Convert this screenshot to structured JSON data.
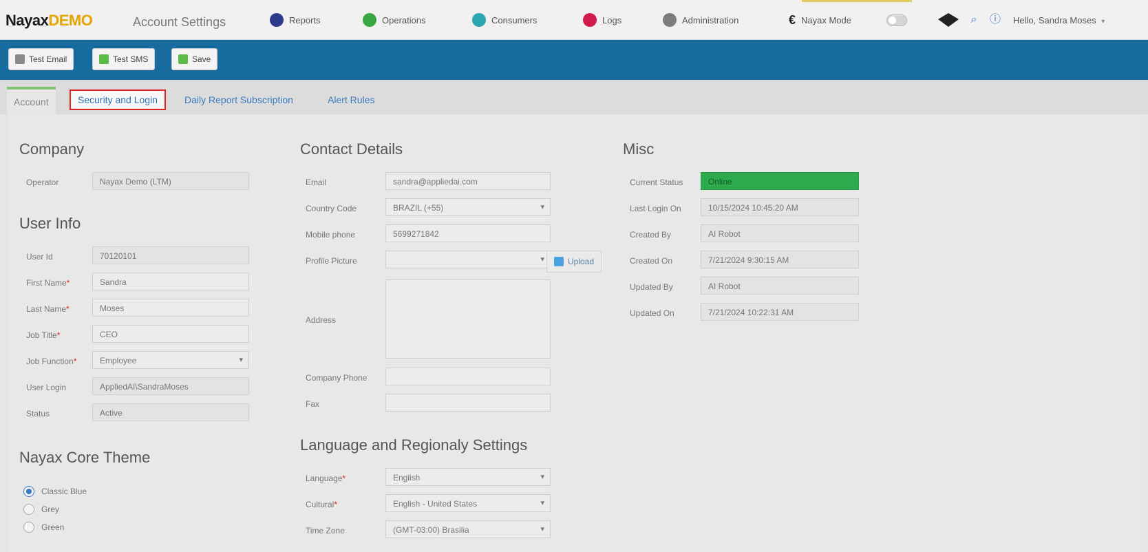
{
  "app": {
    "logo_part1": "Nayax",
    "logo_part2": "DEMO",
    "page_title": "Account Settings"
  },
  "nav": {
    "items": [
      {
        "label": "Reports",
        "color": "#2e3a8c",
        "icon": "reports-icon"
      },
      {
        "label": "Operations",
        "color": "#3aa641",
        "icon": "operations-icon"
      },
      {
        "label": "Consumers",
        "color": "#2aa7b0",
        "icon": "consumers-icon"
      },
      {
        "label": "Logs",
        "color": "#d21b4d",
        "icon": "logs-icon"
      },
      {
        "label": "Administration",
        "color": "#7d7d7d",
        "icon": "administration-icon"
      }
    ],
    "mode_label": "Nayax Mode",
    "user_name": "Hello, Sandra Moses"
  },
  "toolbar": {
    "buttons": [
      {
        "label": "Test Email",
        "color": "#8a8a8a",
        "icon": "email-icon"
      },
      {
        "label": "Test SMS",
        "color": "#5cba47",
        "icon": "sms-icon"
      },
      {
        "label": "Save",
        "color": "#5cba47",
        "icon": "save-icon"
      }
    ]
  },
  "tabs": [
    {
      "label": "Account"
    },
    {
      "label": "Security and Login"
    },
    {
      "label": "Daily Report Subscription"
    },
    {
      "label": "Alert Rules"
    }
  ],
  "company": {
    "title": "Company",
    "operator_label": "Operator",
    "operator_value": "Nayax Demo (LTM)"
  },
  "user_info": {
    "title": "User Info",
    "user_id_label": "User Id",
    "user_id_value": "70120101",
    "first_name_label": "First Name",
    "first_name_value": "Sandra",
    "last_name_label": "Last Name",
    "last_name_value": "Moses",
    "job_title_label": "Job Title",
    "job_title_value": "CEO",
    "job_function_label": "Job Function",
    "job_function_value": "Employee",
    "user_login_label": "User Login",
    "user_login_value": "AppliedAI\\SandraMoses",
    "status_label": "Status",
    "status_value": "Active"
  },
  "theme": {
    "title": "Nayax Core Theme",
    "options": [
      "Classic Blue",
      "Grey",
      "Green"
    ],
    "selected": "Classic Blue"
  },
  "contact": {
    "title": "Contact Details",
    "email_label": "Email",
    "email_value": "sandra@appliedai.com",
    "country_code_label": "Country Code",
    "country_code_value": "BRAZIL (+55)",
    "mobile_label": "Mobile phone",
    "mobile_value": "5699271842",
    "profile_picture_label": "Profile Picture",
    "profile_picture_value": "",
    "upload_label": "Upload",
    "address_label": "Address",
    "address_value": "",
    "company_phone_label": "Company Phone",
    "company_phone_value": "",
    "fax_label": "Fax",
    "fax_value": ""
  },
  "language": {
    "title": "Language and Regionaly Settings",
    "language_label": "Language",
    "language_value": "English",
    "cultural_label": "Cultural",
    "cultural_value": "English - United States",
    "timezone_label": "Time Zone",
    "timezone_value": "(GMT-03:00) Brasilia"
  },
  "misc": {
    "title": "Misc",
    "current_status_label": "Current Status",
    "current_status_value": "Online",
    "last_login_label": "Last Login On",
    "last_login_value": "10/15/2024 10:45:20 AM",
    "created_by_label": "Created By",
    "created_by_value": "AI Robot",
    "created_on_label": "Created On",
    "created_on_value": "7/21/2024 9:30:15 AM",
    "updated_by_label": "Updated By",
    "updated_by_value": "AI Robot",
    "updated_on_label": "Updated On",
    "updated_on_value": "7/21/2024 10:22:31 AM"
  }
}
